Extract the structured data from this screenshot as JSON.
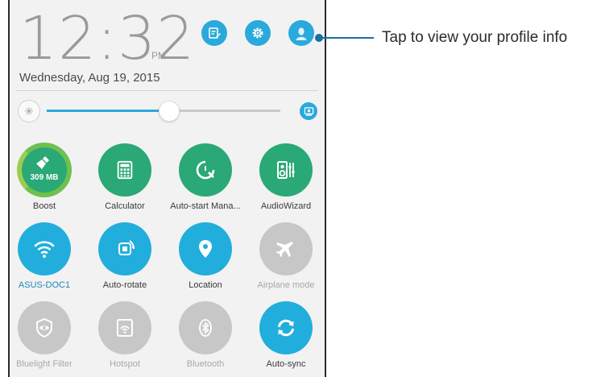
{
  "clock": {
    "time": "12:32",
    "ampm": "PM",
    "date": "Wednesday, Aug 19, 2015"
  },
  "top_buttons": [
    {
      "icon": "quick-note-icon"
    },
    {
      "icon": "gear-icon"
    },
    {
      "icon": "profile-avatar-icon"
    }
  ],
  "brightness": {
    "level": 0.52,
    "left_icon": "brightness-icon",
    "right_icon": "auto-brightness-icon"
  },
  "tiles": [
    {
      "label": "Boost",
      "state": "on",
      "badge": "309 MB",
      "icon": "broom-icon"
    },
    {
      "label": "Calculator",
      "state": "on",
      "icon": "calculator-icon"
    },
    {
      "label": "Auto-start Mana...",
      "state": "on",
      "icon": "wrench-icon"
    },
    {
      "label": "AudioWizard",
      "state": "on",
      "icon": "speaker-icon"
    },
    {
      "label": "ASUS-DOC1",
      "state": "on",
      "icon": "wifi-icon"
    },
    {
      "label": "Auto-rotate",
      "state": "on",
      "icon": "rotate-icon"
    },
    {
      "label": "Location",
      "state": "on",
      "icon": "location-pin-icon"
    },
    {
      "label": "Airplane mode",
      "state": "off",
      "icon": "airplane-icon"
    },
    {
      "label": "Bluelight Filter",
      "state": "off",
      "icon": "eye-icon"
    },
    {
      "label": "Hotspot",
      "state": "off",
      "icon": "hotspot-icon"
    },
    {
      "label": "Bluetooth",
      "state": "off",
      "icon": "bluetooth-icon"
    },
    {
      "label": "Auto-sync",
      "state": "on",
      "icon": "sync-icon"
    }
  ],
  "callout": {
    "text": "Tap to view your profile info"
  },
  "colors": {
    "accent_blue": "#22aedc",
    "accent_green": "#2aa876",
    "off_grey": "#c7c7c7",
    "callout": "#1c6fa0"
  }
}
